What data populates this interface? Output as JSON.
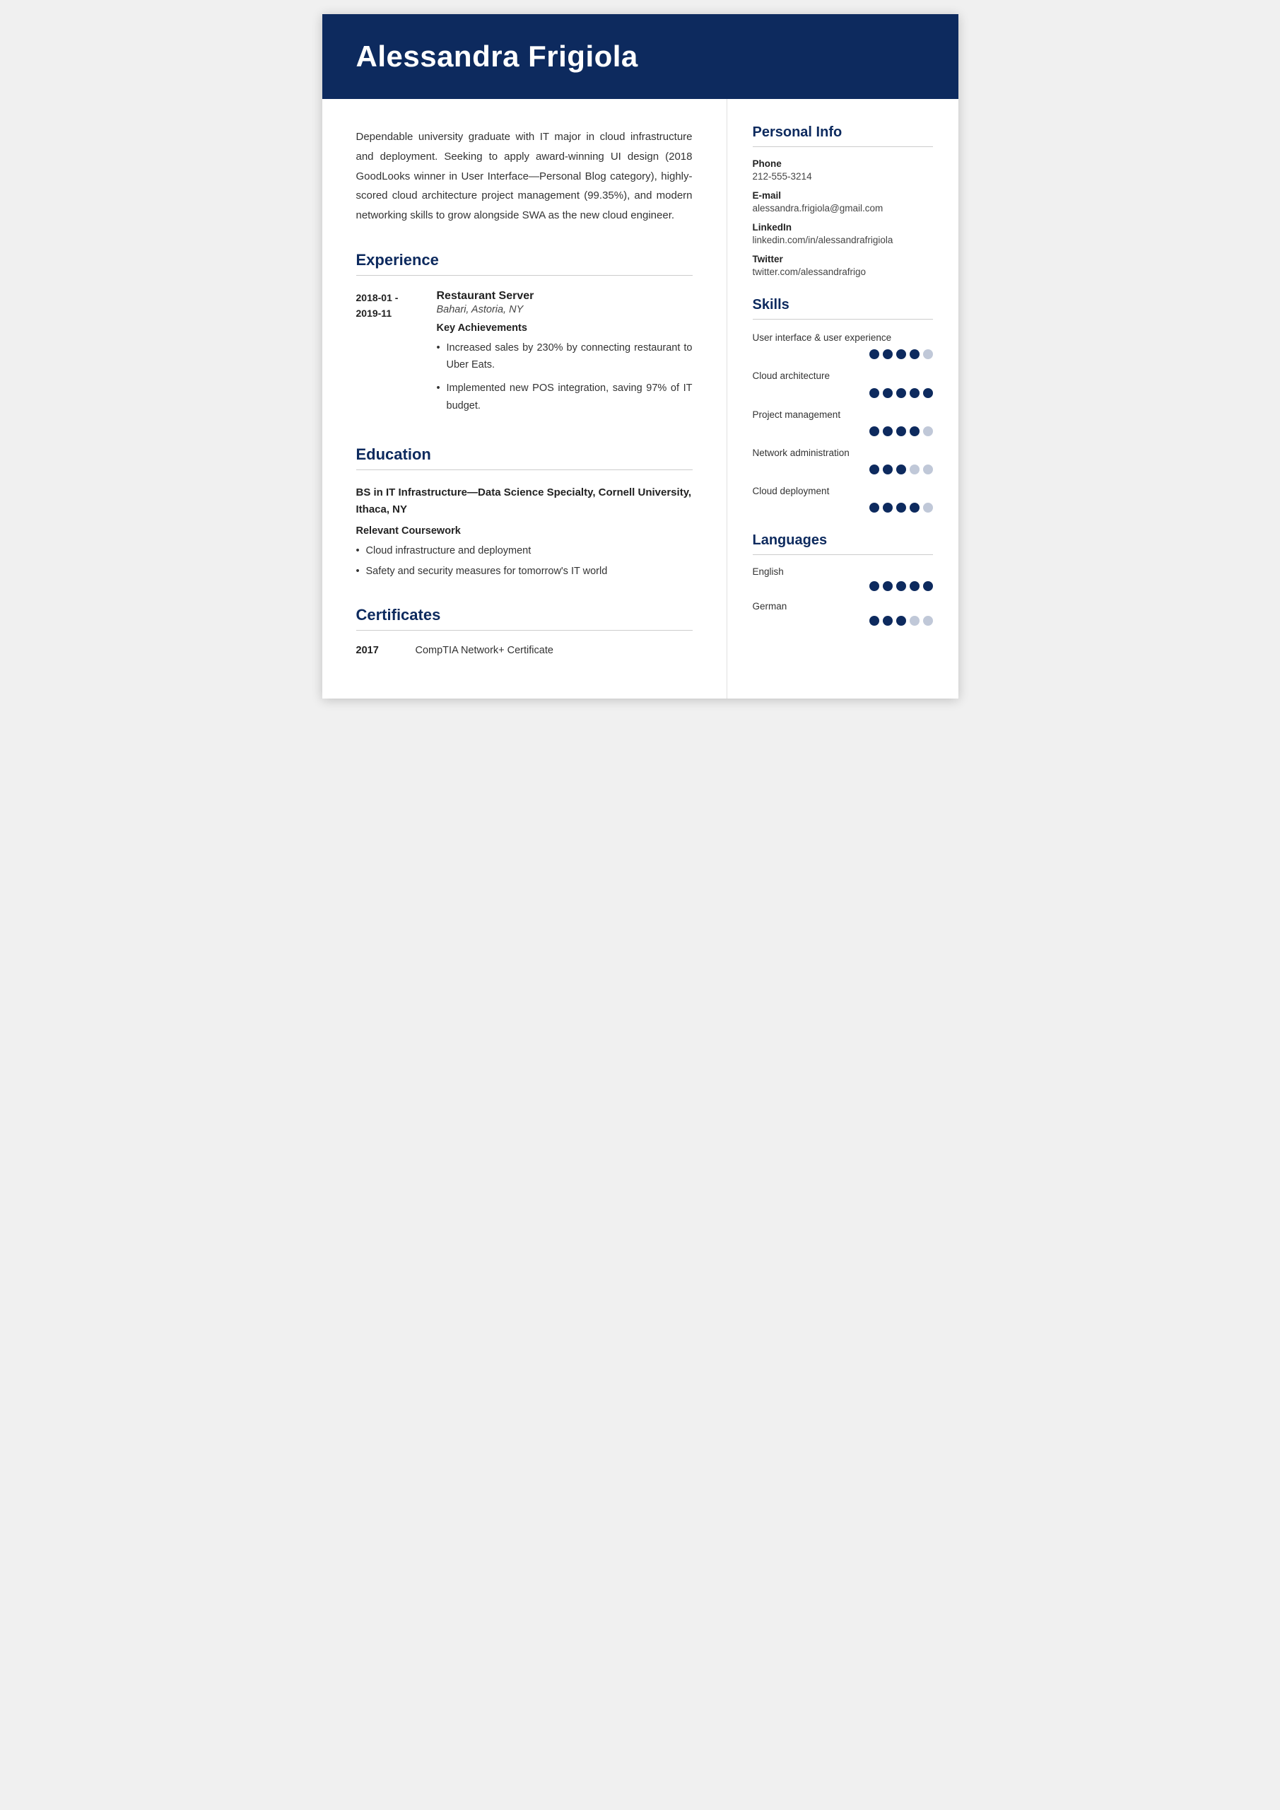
{
  "header": {
    "name": "Alessandra Frigiola"
  },
  "summary": "Dependable university graduate with IT major in cloud infrastructure and deployment. Seeking to apply award-winning UI design (2018 GoodLooks winner in User Interface—Personal Blog category), highly-scored cloud architecture project management (99.35%), and modern networking skills to grow alongside SWA as the new cloud engineer.",
  "sections": {
    "experience_label": "Experience",
    "education_label": "Education",
    "certificates_label": "Certificates",
    "personal_info_label": "Personal Info",
    "skills_label": "Skills",
    "languages_label": "Languages"
  },
  "experience": [
    {
      "date_start": "2018-01 -",
      "date_end": "2019-11",
      "title": "Restaurant Server",
      "company": "Bahari, Astoria, NY",
      "achievements_label": "Key Achievements",
      "achievements": [
        "Increased sales by 230% by connecting restaurant to Uber Eats.",
        "Implemented new POS integration, saving 97% of IT budget."
      ]
    }
  ],
  "education": {
    "degree": "BS in IT Infrastructure—Data Science Specialty, Cornell University, Ithaca, NY",
    "coursework_label": "Relevant Coursework",
    "coursework": [
      "Cloud infrastructure and deployment",
      "Safety and security measures for tomorrow's IT world"
    ]
  },
  "certificates": [
    {
      "year": "2017",
      "name": "CompTIA Network+ Certificate"
    }
  ],
  "personal_info": {
    "phone_label": "Phone",
    "phone_value": "212-555-3214",
    "email_label": "E-mail",
    "email_value": "alessandra.frigiola@gmail.com",
    "linkedin_label": "LinkedIn",
    "linkedin_value": "linkedin.com/in/alessandrafrigiola",
    "twitter_label": "Twitter",
    "twitter_value": "twitter.com/alessandrafrigo"
  },
  "skills": [
    {
      "name": "User interface & user experience",
      "filled": 4,
      "total": 5
    },
    {
      "name": "Cloud architecture",
      "filled": 5,
      "total": 5
    },
    {
      "name": "Project management",
      "filled": 4,
      "total": 5
    },
    {
      "name": "Network administration",
      "filled": 3,
      "total": 5
    },
    {
      "name": "Cloud deployment",
      "filled": 4,
      "total": 5
    }
  ],
  "languages": [
    {
      "name": "English",
      "filled": 5,
      "total": 5
    },
    {
      "name": "German",
      "filled": 3,
      "total": 5
    }
  ]
}
